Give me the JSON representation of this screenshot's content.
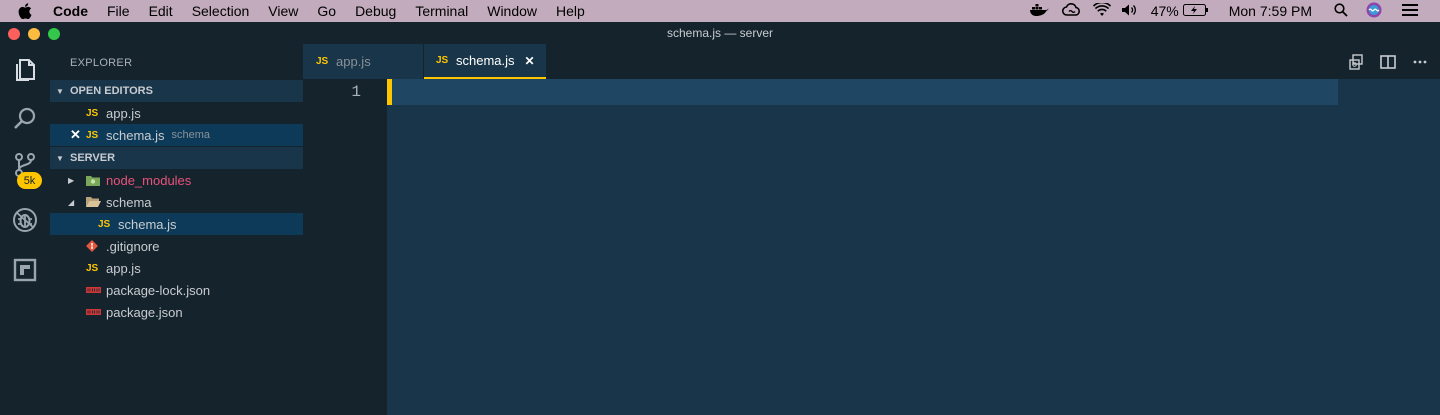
{
  "menubar": {
    "app": "Code",
    "items": [
      "File",
      "Edit",
      "Selection",
      "View",
      "Go",
      "Debug",
      "Terminal",
      "Window",
      "Help"
    ],
    "battery": "47%",
    "clock": "Mon 7:59 PM"
  },
  "window": {
    "title": "schema.js — server"
  },
  "activity": {
    "scm_badge": "5k"
  },
  "sidebar": {
    "title": "EXPLORER",
    "open_editors": {
      "header": "OPEN EDITORS",
      "items": [
        {
          "icon": "JS",
          "name": "app.js",
          "hint": ""
        },
        {
          "icon": "JS",
          "name": "schema.js",
          "hint": "schema"
        }
      ]
    },
    "folder": {
      "header": "SERVER",
      "items": [
        {
          "name": "node_modules"
        },
        {
          "name": "schema"
        },
        {
          "icon": "JS",
          "name": "schema.js"
        },
        {
          "name": ".gitignore"
        },
        {
          "icon": "JS",
          "name": "app.js"
        },
        {
          "name": "package-lock.json"
        },
        {
          "name": "package.json"
        }
      ]
    }
  },
  "tabs": [
    {
      "icon": "JS",
      "label": "app.js",
      "active": false
    },
    {
      "icon": "JS",
      "label": "schema.js",
      "active": true
    }
  ],
  "editor": {
    "line_numbers": [
      "1"
    ]
  },
  "colors": {
    "accent": "#ffc600",
    "editor_bg": "#193549",
    "sidebar_bg": "#15232d",
    "selection": "#0d3a58",
    "node_modules_text": "#e8537a"
  }
}
